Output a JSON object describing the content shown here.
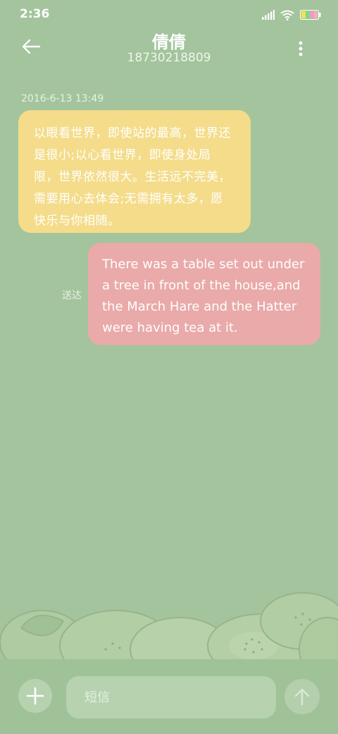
{
  "status": {
    "time": "2:36"
  },
  "header": {
    "name": "倩倩",
    "number": "18730218809"
  },
  "conversation": {
    "timestamp": "2016-6-13 13:49",
    "incoming": "以眼看世界，即使站的最高，世界还是很小;以心看世界，即使身处局限，世界依然很大。生活远不完美，需要用心去体会;无需拥有太多，愿快乐与你相随。",
    "outgoing": "There was a table set out under a tree in front of the house,and the March Hare and the Hatter were having tea at it.",
    "delivered_label": "送达"
  },
  "input": {
    "placeholder": "短信",
    "value": ""
  },
  "colors": {
    "background": "#a3c49d",
    "incoming_bubble": "#f4dc8a",
    "outgoing_bubble": "#e9aaa9"
  }
}
